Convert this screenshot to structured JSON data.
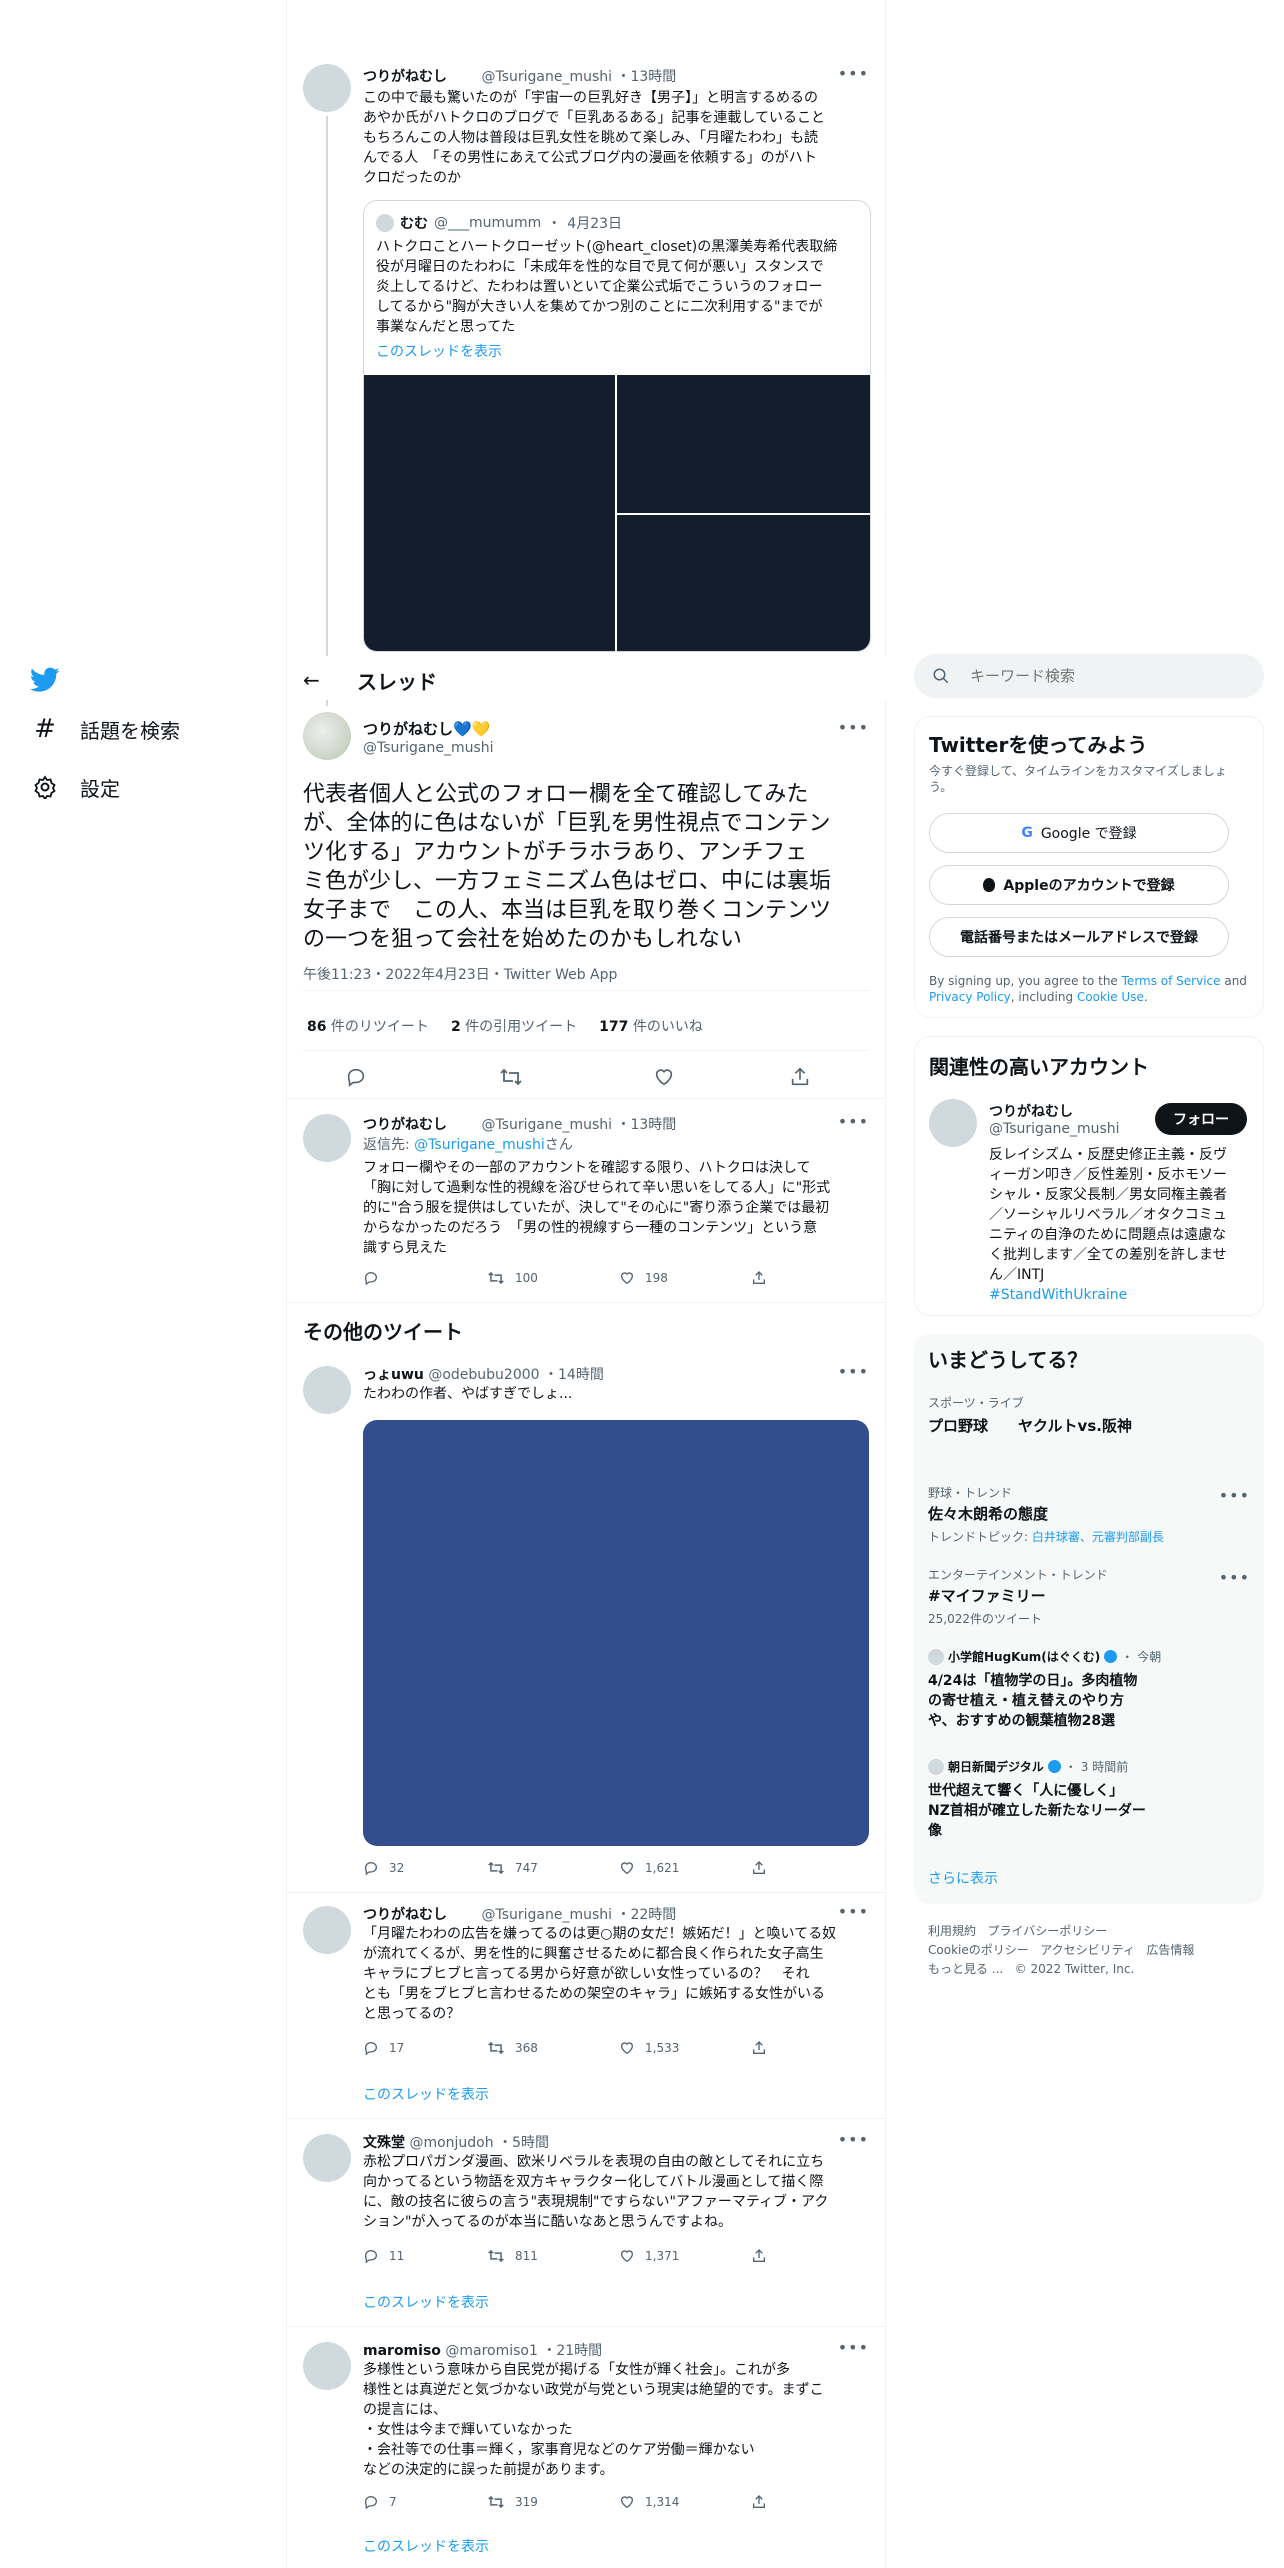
{
  "nav": {
    "explore": "話題を検索",
    "settings": "設定"
  },
  "thread_prev": {
    "name": "つりがねむし",
    "handle": "@Tsurigane_mushi",
    "time": "13時間",
    "text_lines": [
      "この中で最も驚いたのが「宇宙一の巨乳好き【男子】」と明言するめるの",
      "あやか氏がハトクロのブログで「巨乳あるある」記事を連載していること",
      "もちろんこの人物は普段は巨乳女性を眺めて楽しみ、「月曜たわわ」も読",
      "んでる人　「その男性にあえて公式ブログ内の漫画を依頼する」のがハト",
      "クロだったのか"
    ],
    "quote": {
      "name": "むむ",
      "handle": "@___mumumm",
      "date": "4月23日",
      "text_lines": [
        "ハトクロことハートクローゼット(@heart_closet)の黒澤美寿希代表取締",
        "役が月曜日のたわわに「未成年を性的な目で見て何が悪い」スタンスで",
        "炎上してるけど、たわわは置いといて企業公式垢でこういうのフォロー",
        "してるから\"胸が大きい人を集めてかつ別のことに二次利用する\"までが",
        "事業なんだと思ってた"
      ],
      "show_thread": "このスレッドを表示"
    }
  },
  "header": {
    "title": "スレッド"
  },
  "main_tweet": {
    "name": "つりがねむし💙💛",
    "handle": "@Tsurigane_mushi",
    "text_lines": [
      "代表者個人と公式のフォロー欄を全て確認してみた",
      "が、全体的に色はないが「巨乳を男性視点でコンテン",
      "ツ化する」アカウントがチラホラあり、アンチフェ",
      "ミ色が少し、一方フェミニズム色はゼロ、中には裏垢",
      "女子まで　この人、本当は巨乳を取り巻くコンテンツ",
      "の一つを狙って会社を始めたのかもしれない"
    ],
    "meta": "午後11:23・2022年4月23日・Twitter Web App",
    "retweets_count": "86",
    "retweets_label": " 件のリツイート",
    "quotes_count": "2",
    "quotes_label": " 件の引用ツイート",
    "likes_count": "177",
    "likes_label": " 件のいいね"
  },
  "reply": {
    "name": "つりがねむし",
    "handle": "@Tsurigane_mushi",
    "time": "13時間",
    "reply_prefix": "返信先: ",
    "reply_to": "@Tsurigane_mushi",
    "reply_suffix": "さん",
    "text_lines": [
      "フォロー欄やその一部のアカウントを確認する限り、ハトクロは決して",
      "「胸に対して過剰な性的視線を浴びせられて辛い思いをしてる人」に\"形式",
      "的に\"合う服を提供はしていたが、決して\"その心に\"寄り添う企業では最初",
      "からなかったのだろう　「男の性的視線すら一種のコンテンツ」という意",
      "識すら見えた"
    ],
    "retweets": "100",
    "likes": "198"
  },
  "more_tweets_heading": "その他のツイート",
  "tweets": [
    {
      "name": "っょuwu",
      "handle": "@odebubu2000",
      "time": "14時間",
      "text_lines": [
        "たわわの作者、やばすぎでしょ..."
      ],
      "replies": "32",
      "retweets": "747",
      "likes": "1,621"
    },
    {
      "name": "つりがねむし",
      "handle": "@Tsurigane_mushi",
      "time": "22時間",
      "text_lines": [
        "「月曜たわわの広告を嫌ってるのは更○期の女だ！嫉妬だ！」と喚いてる奴",
        "が流れてくるが、男を性的に興奮させるために都合良く作られた女子高生",
        "キャラにブヒブヒ言ってる男から好意が欲しい女性っているの？　それ",
        "とも「男をブヒブヒ言わせるための架空のキャラ」に嫉妬する女性がいる",
        "と思ってるの？"
      ],
      "replies": "17",
      "retweets": "368",
      "likes": "1,533",
      "show_thread": "このスレッドを表示"
    },
    {
      "name": "文殊堂",
      "handle": "@monjudoh",
      "time": "5時間",
      "text_lines": [
        "赤松プロパガンダ漫画、欧米リベラルを表現の自由の敵としてそれに立ち",
        "向かってるという物語を双方キャラクター化してバトル漫画として描く際",
        "に、敵の技名に彼らの言う\"表現規制\"ですらない\"アファーマティブ・アク",
        "ション\"が入ってるのが本当に酷いなあと思うんですよね。"
      ],
      "replies": "11",
      "retweets": "811",
      "likes": "1,371",
      "show_thread": "このスレッドを表示"
    },
    {
      "name": "maromiso",
      "handle": "@maromiso1",
      "time": "21時間",
      "text_lines": [
        "多様性という意味から自民党が掲げる「女性が輝く社会」。これが多",
        "様性とは真逆だと気づかない政党が与党という現実は絶望的です。まずこ",
        "の提言には、",
        "・女性は今まで輝いていなかった",
        "・会社等での仕事＝輝く，家事育児などのケア労働＝輝かない",
        "などの決定的に誤った前提があります。"
      ],
      "replies": "7",
      "retweets": "319",
      "likes": "1,314",
      "show_thread": "このスレッドを表示"
    }
  ],
  "search": {
    "placeholder": "キーワード検索"
  },
  "signup": {
    "title": "Twitterを使ってみよう",
    "subtitle_lines": [
      "今すぐ登録して、タイムラインをカスタマイズしましょ",
      "う。"
    ],
    "google": "Google で登録",
    "apple": "Appleのアカウントで登録",
    "phone": "電話番号またはメールアドレスで登録",
    "terms_pre": "By signing up, you agree to the ",
    "terms_link": "Terms of Service",
    "terms_and": " and",
    "privacy_link": "Privacy Policy",
    "terms_including": ", including ",
    "cookie_link": "Cookie Use",
    "terms_end": "."
  },
  "related": {
    "title": "関連性の高いアカウント",
    "name": "つりがねむし",
    "handle": "@Tsurigane_mushi",
    "follow": "フォロー",
    "bio_lines": [
      "反レイシズム・反歴史修正主義・反ヴ",
      "ィーガン叩き／反性差別・反ホモソー",
      "シャル・反家父長制／男女同権主義者",
      "／ソーシャルリベラル／オタクコミュ",
      "ニティの自浄のために問題点は遠慮な",
      "く批判します／全ての差別を許しませ",
      "ん／INTJ"
    ],
    "hashtag": "#StandWithUkraine"
  },
  "trends": {
    "title": "いまどうしてる？",
    "items": [
      {
        "context": "スポーツ・ライブ",
        "title": "プロ野球　　ヤクルトvs.阪神"
      },
      {
        "context": "野球・トレンド",
        "title": "佐々木朗希の態度",
        "sub_prefix": "トレンドトピック: ",
        "sub_links": "白井球審、元審判部副長"
      },
      {
        "context": "エンターテインメント・トレンド",
        "title": "#マイファミリー",
        "sub": "25,022件のツイート"
      }
    ],
    "news": [
      {
        "source": "小学館HugKum(はぐくむ)",
        "time": "今朝",
        "lines": [
          "4/24は「植物学の日」。多肉植物",
          "の寄せ植え・植え替えのやり方",
          "や、おすすめの観葉植物28選"
        ]
      },
      {
        "source": "朝日新聞デジタル",
        "time": "3 時間前",
        "lines": [
          "世代超えて響く「人に優しく」",
          "NZ首相が確立した新たなリーダー",
          "像"
        ]
      }
    ],
    "show_more": "さらに表示"
  },
  "footer": {
    "line1": [
      "利用規約",
      "プライバシーポリシー"
    ],
    "line2": [
      "Cookieのポリシー",
      "アクセシビリティ",
      "広告情報"
    ],
    "more": "もっと見る ...",
    "copyright": "© 2022 Twitter, Inc."
  },
  "colors": {
    "accent": "#1d9bf0",
    "image_dark": "#141d2b",
    "image_blue": "#334e8c"
  }
}
